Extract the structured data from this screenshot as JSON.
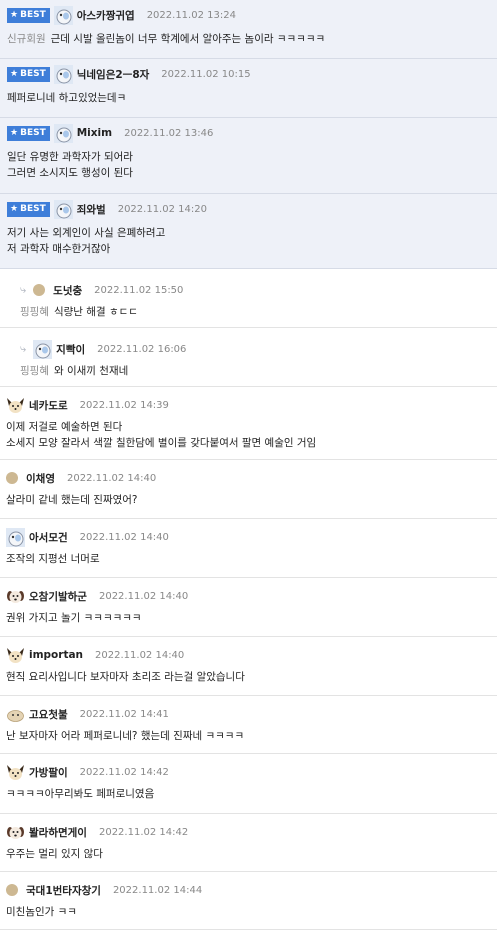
{
  "best_label": "BEST",
  "comments": [
    {
      "kind": "best",
      "avatar": "mole-icon",
      "nick": "아스카짱귀엽",
      "date": "2022.11.02 13:24",
      "mention": "신규회원",
      "lines": [
        "근데 시발 올린놈이 너무 학계에서 알아주는 놈이라 ㅋㅋㅋㅋㅋ"
      ]
    },
    {
      "kind": "best",
      "avatar": "mole-icon",
      "nick": "닉네임은2ㅡ8자",
      "date": "2022.11.02 10:15",
      "mention": "",
      "lines": [
        "페퍼로니네 하고있었는데ㅋ"
      ]
    },
    {
      "kind": "best",
      "avatar": "mole-icon",
      "nick": "Mixim",
      "date": "2022.11.02 13:46",
      "mention": "",
      "lines": [
        "일단 유명한 과학자가 되어라",
        "그러면 소시지도 행성이 된다"
      ]
    },
    {
      "kind": "best",
      "avatar": "mole-icon",
      "nick": "죄와벌",
      "date": "2022.11.02 14:20",
      "mention": "",
      "lines": [
        "저기 사는 외계인이 사실 은폐하려고",
        "저 과학자 매수한거잖아"
      ]
    },
    {
      "kind": "reply",
      "avatar": "dot-icon",
      "nick": "도넛충",
      "date": "2022.11.02 15:50",
      "mention": "핑핑혜",
      "lines": [
        "식량난 해결 ㅎㄷㄷ"
      ]
    },
    {
      "kind": "reply",
      "avatar": "mole-icon",
      "nick": "지빡이",
      "date": "2022.11.02 16:06",
      "mention": "핑핑혜",
      "lines": [
        "와 이새끼 천재네"
      ]
    },
    {
      "kind": "normal",
      "avatar": "fox-icon",
      "nick": "네카도로",
      "date": "2022.11.02 14:39",
      "mention": "",
      "lines": [
        "이제 저걸로 예술하면 된다",
        "소세지 모양 잘라서 색깔 칠한담에 별이를 갖다붙여서 팔면 예술인 거임"
      ]
    },
    {
      "kind": "normal",
      "avatar": "dot-icon",
      "nick": "이채영",
      "date": "2022.11.02 14:40",
      "mention": "",
      "lines": [
        "살라미 같네 했는데 진짜였어?"
      ]
    },
    {
      "kind": "normal",
      "avatar": "mole-icon",
      "nick": "아서모건",
      "date": "2022.11.02 14:40",
      "mention": "",
      "lines": [
        "조작의 지평선 너머로"
      ]
    },
    {
      "kind": "normal",
      "avatar": "puppy-icon",
      "nick": "오참기발하군",
      "date": "2022.11.02 14:40",
      "mention": "",
      "lines": [
        "권위 가지고 놀기 ㅋㅋㅋㅋㅋㅋ"
      ]
    },
    {
      "kind": "normal",
      "avatar": "fox-icon",
      "nick": "importan",
      "date": "2022.11.02 14:40",
      "mention": "",
      "lines": [
        "현직 요리사입니다 보자마자 초리조 라는걸 알았습니다"
      ]
    },
    {
      "kind": "normal",
      "avatar": "blob-icon",
      "nick": "고요첫불",
      "date": "2022.11.02 14:41",
      "mention": "",
      "lines": [
        "난 보자마자 어라 페퍼로니네? 했는데 진짜네 ㅋㅋㅋㅋ"
      ]
    },
    {
      "kind": "normal",
      "avatar": "fox-icon",
      "nick": "가방팔이",
      "date": "2022.11.02 14:42",
      "mention": "",
      "lines": [
        "ㅋㅋㅋㅋ아무리봐도 페퍼로니였음"
      ]
    },
    {
      "kind": "normal",
      "avatar": "puppy-icon",
      "nick": "봘라하면게이",
      "date": "2022.11.02 14:42",
      "mention": "",
      "lines": [
        "우주는 멀리 있지 않다"
      ]
    },
    {
      "kind": "normal",
      "avatar": "dot-icon",
      "nick": "국대1번타자창기",
      "date": "2022.11.02 14:44",
      "mention": "",
      "lines": [
        "미친놈인가 ㅋㅋ"
      ]
    }
  ]
}
